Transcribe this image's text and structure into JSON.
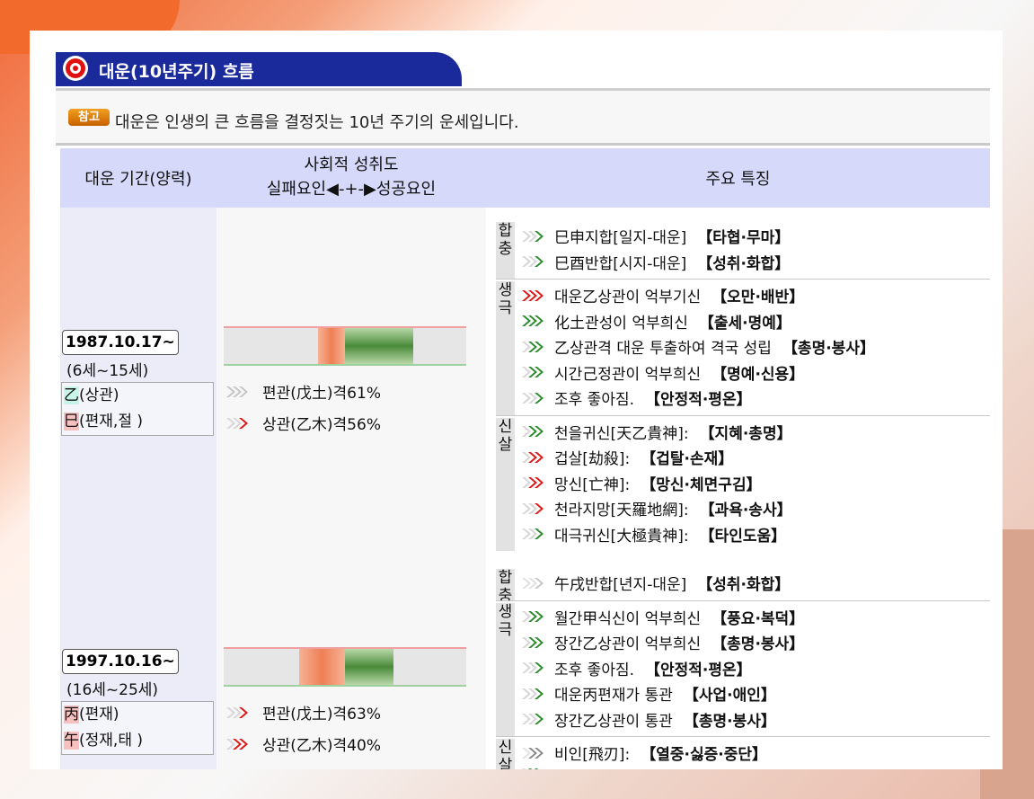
{
  "section_title": "대운(10년주기) 흐름",
  "notice": {
    "badge": "참고",
    "text": "대운은 인생의 큰 흐름을 결정짓는 10년 주기의 운세입니다."
  },
  "header": {
    "period": "대운 기간(양력)",
    "achievement_title": "사회적 성취도",
    "achievement_scale": "실패요인◀-+-▶성공요인",
    "features": "주요 특징"
  },
  "colors": {
    "title_bg": "#1a2a9a",
    "header_bg": "#d6d9fa",
    "green_arrow": "#2e8b2e",
    "red_arrow": "#e01818",
    "gray_arrow": "#bdbdbd"
  },
  "periods": [
    {
      "date": "1987.10.17~",
      "age": "(6세~15세)",
      "ganji": [
        {
          "char": "乙",
          "rest": "(상관)",
          "hl": "green"
        },
        {
          "char": "巳",
          "rest": "(편재,절 )",
          "hl": "red"
        }
      ],
      "bar": {
        "red_fraction": [
          0.39,
          0.5
        ],
        "green_fraction": [
          0.5,
          0.78
        ]
      },
      "factors": [
        {
          "arrow": "gray3",
          "text": "편관(戊土)격61%"
        },
        {
          "arrow": "red1",
          "text": "상관(乙木)격56%"
        }
      ],
      "groups": [
        {
          "label": "합충",
          "items": [
            {
              "arrow": "green1",
              "text": "巳申지합[일지-대운]",
              "tag": "【타협·무마】"
            },
            {
              "arrow": "green1",
              "text": "巳酉반합[시지-대운]",
              "tag": "【성취·화합】"
            }
          ]
        },
        {
          "label": "생극",
          "items": [
            {
              "arrow": "red3",
              "text": "대운乙상관이 억부기신",
              "tag": "【오만·배반】"
            },
            {
              "arrow": "green3",
              "text": "化土관성이 억부희신",
              "tag": "【출세·명예】"
            },
            {
              "arrow": "green2",
              "text": "乙상관격 대운 투출하여 격국 성립",
              "tag": "【총명·봉사】"
            },
            {
              "arrow": "green2",
              "text": "시간己정관이 억부희신",
              "tag": "【명예·신용】"
            },
            {
              "arrow": "green1",
              "text": "조후 좋아짐.",
              "tag": "【안정적·평온】"
            }
          ]
        },
        {
          "label": "신살",
          "items": [
            {
              "arrow": "green2",
              "text": "천을귀신[天乙貴神]:",
              "tag": "【지혜·총명】"
            },
            {
              "arrow": "red2",
              "text": "겁살[劫殺]:",
              "tag": "【겁탈·손재】"
            },
            {
              "arrow": "red2",
              "text": "망신[亡神]:",
              "tag": "【망신·체면구김】"
            },
            {
              "arrow": "red1",
              "text": "천라지망[天羅地網]:",
              "tag": "【과욕·송사】"
            },
            {
              "arrow": "green1",
              "text": "대극귀신[大極貴神]:",
              "tag": "【타인도움】"
            }
          ]
        }
      ]
    },
    {
      "date": "1997.10.16~",
      "age": "(16세~25세)",
      "ganji": [
        {
          "char": "丙",
          "rest": "(편재)",
          "hl": "red"
        },
        {
          "char": "午",
          "rest": "(정재,태 )",
          "hl": "red"
        }
      ],
      "bar": {
        "red_fraction": [
          0.31,
          0.5
        ],
        "green_fraction": [
          0.5,
          0.7
        ]
      },
      "factors": [
        {
          "arrow": "red1",
          "text": "편관(戊土)격63%"
        },
        {
          "arrow": "red2",
          "text": "상관(乙木)격40%"
        }
      ],
      "groups": [
        {
          "label": "합충",
          "items": [
            {
              "arrow": "gray1",
              "text": "午戌반합[년지-대운]",
              "tag": "【성취·화합】"
            }
          ]
        },
        {
          "label": "생극",
          "items": [
            {
              "arrow": "green2",
              "text": "월간甲식신이 억부희신",
              "tag": "【풍요·복덕】"
            },
            {
              "arrow": "green2",
              "text": "장간乙상관이 억부희신",
              "tag": "【총명·봉사】"
            },
            {
              "arrow": "green1",
              "text": "조후 좋아짐.",
              "tag": "【안정적·평온】"
            },
            {
              "arrow": "green1",
              "text": "대운丙편재가 통관",
              "tag": "【사업·애인】"
            },
            {
              "arrow": "green1",
              "text": "장간乙상관이 통관",
              "tag": "【총명·봉사】"
            }
          ]
        },
        {
          "label": "신살",
          "items": [
            {
              "arrow": "dgray2",
              "text": "비인[飛刃]:",
              "tag": "【열중·싫증·중단】"
            },
            {
              "arrow": "green2",
              "text": "",
              "tag": ""
            }
          ]
        }
      ]
    }
  ]
}
